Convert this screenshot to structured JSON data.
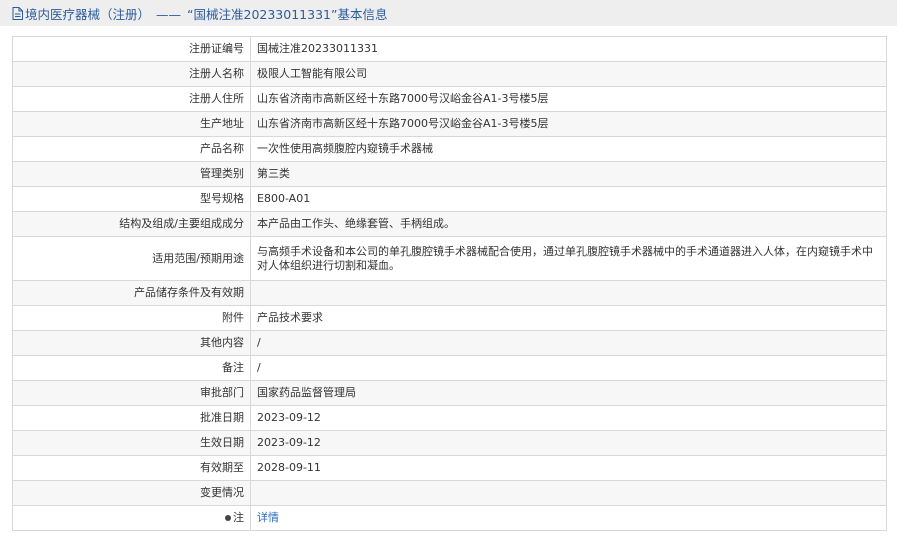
{
  "header": {
    "category": "境内医疗器械（注册）",
    "separator": "——",
    "subject": "“国械注准20233011331”基本信息"
  },
  "rows": [
    {
      "label": "注册证编号",
      "value": "国械注准20233011331"
    },
    {
      "label": "注册人名称",
      "value": "极限人工智能有限公司"
    },
    {
      "label": "注册人住所",
      "value": "山东省济南市高新区经十东路7000号汉峪金谷A1-3号楼5层"
    },
    {
      "label": "生产地址",
      "value": "山东省济南市高新区经十东路7000号汉峪金谷A1-3号楼5层"
    },
    {
      "label": "产品名称",
      "value": "一次性使用高频腹腔内窥镜手术器械"
    },
    {
      "label": "管理类别",
      "value": "第三类"
    },
    {
      "label": "型号规格",
      "value": "E800-A01"
    },
    {
      "label": "结构及组成/主要组成成分",
      "value": "本产品由工作头、绝缘套管、手柄组成。"
    },
    {
      "label": "适用范围/预期用途",
      "value": "与高频手术设备和本公司的单孔腹腔镜手术器械配合使用，通过单孔腹腔镜手术器械中的手术通道器进入人体，在内窥镜手术中对人体组织进行切割和凝血。"
    },
    {
      "label": "产品储存条件及有效期",
      "value": ""
    },
    {
      "label": "附件",
      "value": "产品技术要求"
    },
    {
      "label": "其他内容",
      "value": "/"
    },
    {
      "label": "备注",
      "value": "/"
    },
    {
      "label": "审批部门",
      "value": "国家药品监督管理局"
    },
    {
      "label": "批准日期",
      "value": "2023-09-12"
    },
    {
      "label": "生效日期",
      "value": "2023-09-12"
    },
    {
      "label": "有效期至",
      "value": "2028-09-11"
    },
    {
      "label": "变更情况",
      "value": ""
    }
  ],
  "note": {
    "label": "注",
    "link_text": "详情",
    "icon": "pin-icon"
  }
}
